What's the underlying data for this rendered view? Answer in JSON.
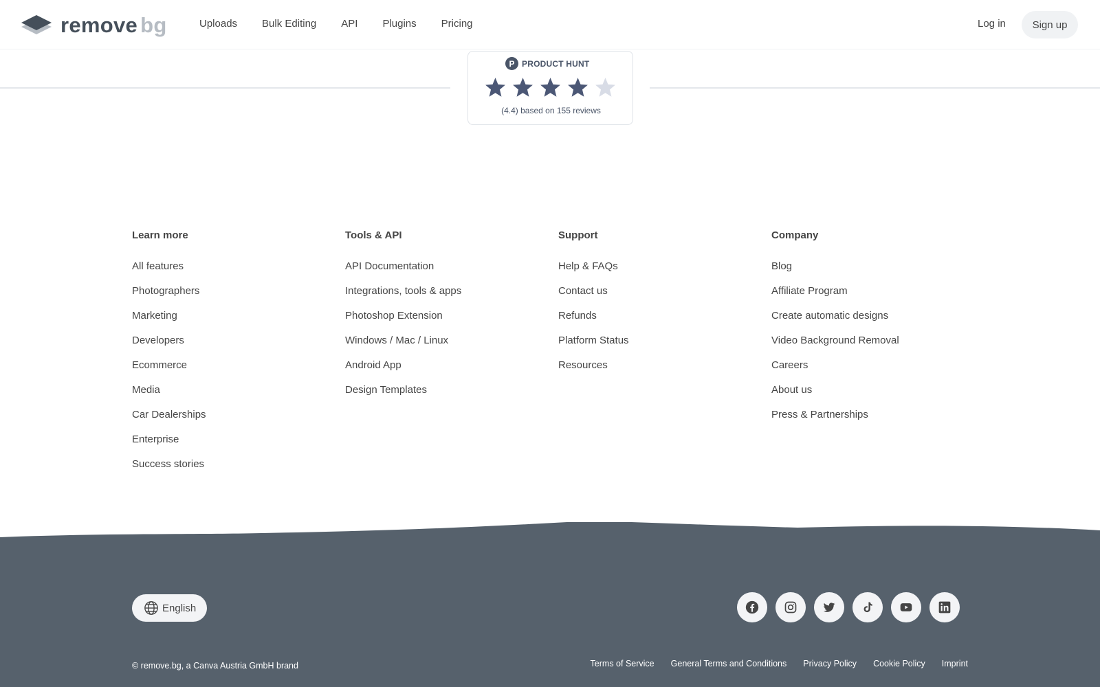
{
  "header": {
    "logo": {
      "word1": "remove",
      "word2": "bg"
    },
    "nav": [
      "Uploads",
      "Bulk Editing",
      "API",
      "Plugins",
      "Pricing"
    ],
    "login_label": "Log in",
    "signup_label": "Sign up"
  },
  "product_hunt": {
    "logo_letter": "P",
    "title": "PRODUCT HUNT",
    "rating": 4.4,
    "max_rating": 5,
    "rating_text": "(4.4) based on 155 reviews"
  },
  "footer": {
    "columns": [
      {
        "title": "Learn more",
        "links": [
          "All features",
          "Photographers",
          "Marketing",
          "Developers",
          "Ecommerce",
          "Media",
          "Car Dealerships",
          "Enterprise",
          "Success stories"
        ]
      },
      {
        "title": "Tools & API",
        "links": [
          "API Documentation",
          "Integrations, tools & apps",
          "Photoshop Extension",
          "Windows / Mac / Linux",
          "Android App",
          "Design Templates"
        ]
      },
      {
        "title": "Support",
        "links": [
          "Help & FAQs",
          "Contact us",
          "Refunds",
          "Platform Status",
          "Resources"
        ]
      },
      {
        "title": "Company",
        "links": [
          "Blog",
          "Affiliate Program",
          "Create automatic designs",
          "Video Background Removal",
          "Careers",
          "About us",
          "Press & Partnerships"
        ]
      }
    ],
    "language_label": "English",
    "social": [
      "facebook-icon",
      "instagram-icon",
      "twitter-icon",
      "tiktok-icon",
      "youtube-icon",
      "linkedin-icon"
    ],
    "copyright": "© remove.bg, a Canva Austria GmbH brand",
    "legal_links": [
      "Terms of Service",
      "General Terms and Conditions",
      "Privacy Policy",
      "Cookie Policy",
      "Imprint"
    ]
  },
  "colors": {
    "footer_bg": "#56616c",
    "star_filled": "#4b5775",
    "star_empty": "#d8dce6",
    "logo_dark": "#454f5a",
    "logo_light": "#b6bcc3"
  }
}
